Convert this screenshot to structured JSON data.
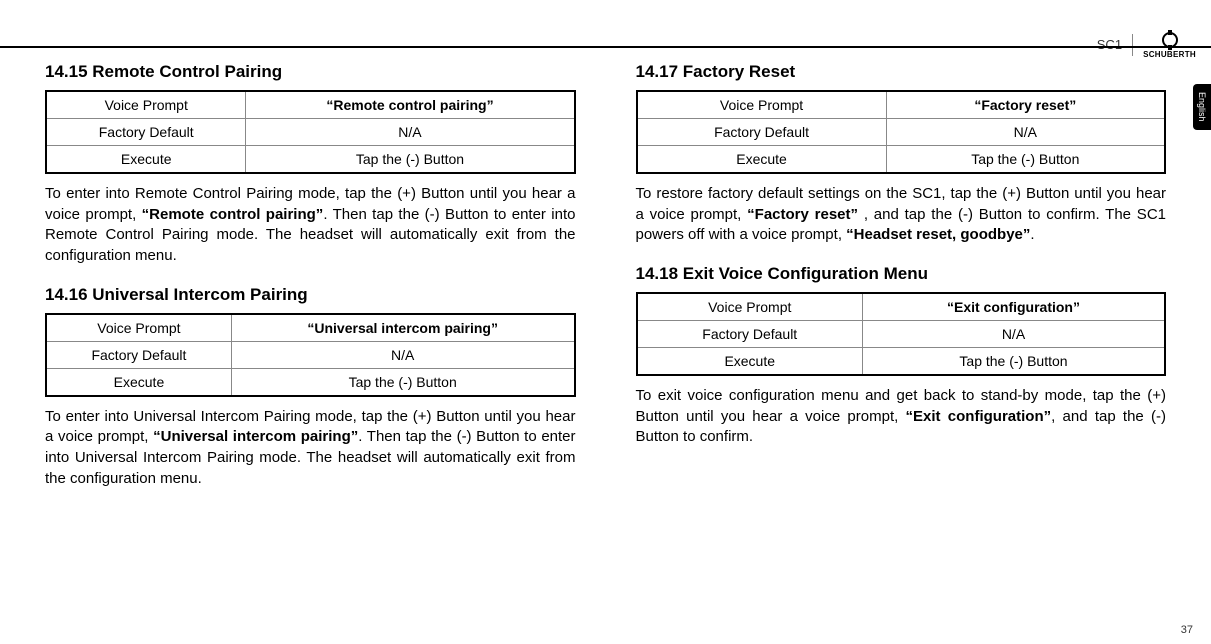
{
  "header": {
    "model": "SC1",
    "brand": "SCHUBERTH",
    "language_tab": "English"
  },
  "page_number": "37",
  "table_labels": {
    "voice_prompt": "Voice Prompt",
    "factory_default": "Factory Default",
    "execute": "Execute"
  },
  "sections": {
    "s1415": {
      "heading": "14.15 Remote Control Pairing",
      "voice_prompt": "“Remote control pairing”",
      "factory_default": "N/A",
      "execute": "Tap the (-) Button",
      "para_pre": "To enter into Remote Control Pairing mode, tap the (+) Button until you hear a voice prompt, ",
      "para_bold": "“Remote control pairing”",
      "para_post": ". Then tap the (-) Button to enter into Remote Control Pairing mode. The headset will automatically exit from the configuration menu."
    },
    "s1416": {
      "heading": "14.16 Universal Intercom Pairing",
      "voice_prompt": "“Universal intercom pairing”",
      "factory_default": "N/A",
      "execute": "Tap the (-) Button",
      "para_pre": "To enter into Universal Intercom Pairing mode, tap the (+) Button until you hear a voice prompt, ",
      "para_bold": "“Universal intercom pairing”",
      "para_post": ". Then tap the (-) Button to enter into Universal Intercom Pairing mode. The headset will automatically exit from the configuration menu."
    },
    "s1417": {
      "heading": "14.17 Factory Reset",
      "voice_prompt": "“Factory reset”",
      "factory_default": "N/A",
      "execute": "Tap the (-) Button",
      "para_pre": "To restore factory default settings on the SC1, tap the (+) Button until you hear a voice prompt, ",
      "para_bold1": "“Factory reset”",
      "para_mid": " , and tap the (-) Button to confirm. The SC1 powers off with a voice prompt, ",
      "para_bold2": "“Headset reset, goodbye”",
      "para_post": "."
    },
    "s1418": {
      "heading": "14.18 Exit Voice Configuration Menu",
      "voice_prompt": "“Exit configuration”",
      "factory_default": "N/A",
      "execute": "Tap the (-) Button",
      "para_pre": "To exit voice configuration menu and get back to stand-by mode, tap the (+) Button until you hear a voice prompt, ",
      "para_bold": "“Exit configuration”",
      "para_post": ", and tap the (-) Button to confirm."
    }
  }
}
